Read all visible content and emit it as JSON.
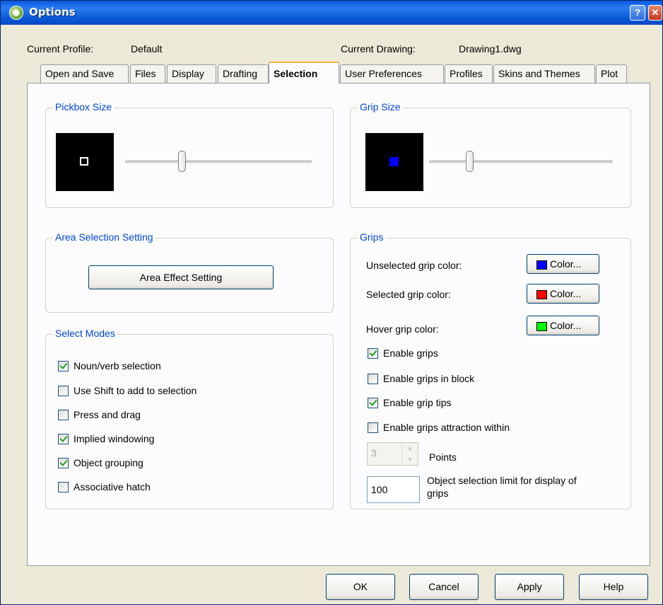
{
  "window": {
    "title": "Options",
    "help_glyph": "?",
    "close_glyph": "✕"
  },
  "profile": {
    "current_profile_label": "Current Profile:",
    "current_profile_value": "Default",
    "current_drawing_label": "Current Drawing:",
    "current_drawing_value": "Drawing1.dwg"
  },
  "tabs": [
    {
      "label": "Open and Save"
    },
    {
      "label": "Files"
    },
    {
      "label": "Display"
    },
    {
      "label": "Drafting"
    },
    {
      "label": "Selection",
      "active": true
    },
    {
      "label": "User Preferences"
    },
    {
      "label": "Profiles"
    },
    {
      "label": "Skins and Themes"
    },
    {
      "label": "Plot"
    }
  ],
  "pickbox": {
    "title": "Pickbox Size"
  },
  "grip_size": {
    "title": "Grip Size",
    "preview_color": "#0000ff"
  },
  "area_selection": {
    "title": "Area Selection Setting",
    "button_label": "Area Effect Setting"
  },
  "select_modes": {
    "title": "Select Modes",
    "items": [
      {
        "label": "Noun/verb selection",
        "checked": true
      },
      {
        "label": "Use Shift to add to selection",
        "checked": false
      },
      {
        "label": "Press and drag",
        "checked": false
      },
      {
        "label": "Implied windowing",
        "checked": true
      },
      {
        "label": "Object grouping",
        "checked": true
      },
      {
        "label": "Associative hatch",
        "checked": false
      }
    ]
  },
  "grips": {
    "title": "Grips",
    "unselected_label": "Unselected grip color:",
    "selected_label": "Selected grip color:",
    "hover_label": "Hover grip color:",
    "color_button_label": "Color...",
    "unselected_color": "#0000ff",
    "selected_color": "#ff0000",
    "hover_color": "#00ff00",
    "options": [
      {
        "label": "Enable grips",
        "checked": true
      },
      {
        "label": "Enable grips in block",
        "checked": false
      },
      {
        "label": "Enable grip tips",
        "checked": true
      },
      {
        "label": "Enable grips attraction within",
        "checked": false
      }
    ],
    "points_value": "3",
    "points_label": "Points",
    "limit_value": "100",
    "limit_label_line1": "Object selection limit for display of",
    "limit_label_line2": "grips"
  },
  "buttons": {
    "ok": "OK",
    "cancel": "Cancel",
    "apply": "Apply",
    "help": "Help"
  }
}
